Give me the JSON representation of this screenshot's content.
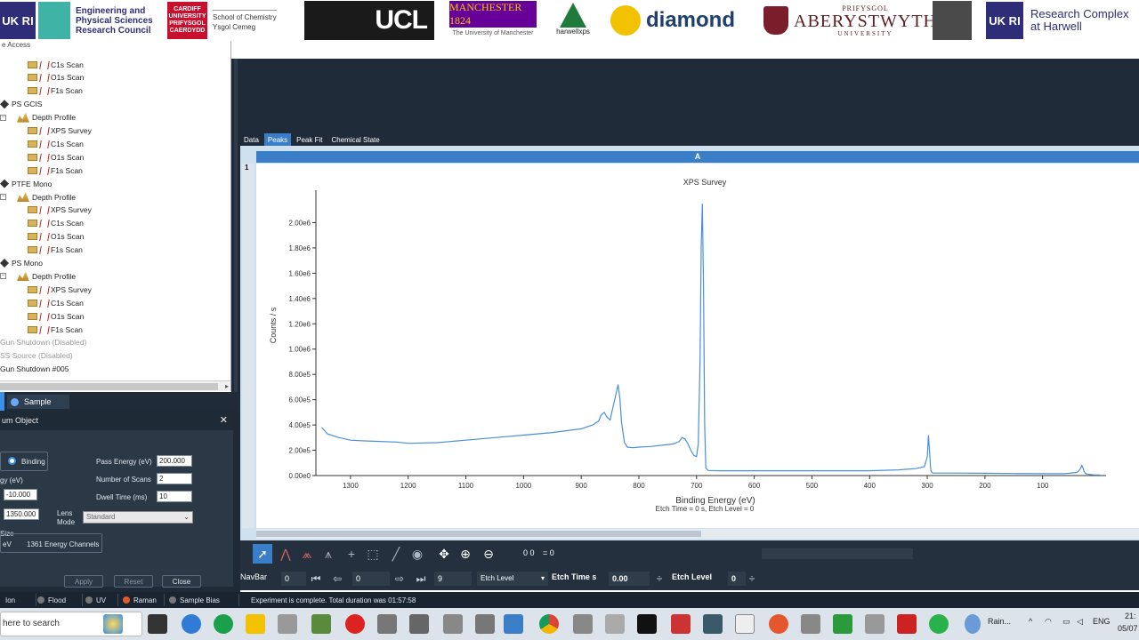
{
  "banner": {
    "ukri_mark": "UK RI",
    "epsrc_lines": [
      "Engineering and",
      "Physical Sciences",
      "Research Council"
    ],
    "cardiff_lines": [
      "CARDIFF",
      "UNIVERSITY",
      "PRIFYSGOL",
      "CAERDYDD"
    ],
    "chem_lines": [
      "School of Chemistry",
      "Ysgol Cemeg"
    ],
    "ucl": "UCL",
    "manchester": "MANCHESTER 1824",
    "manchester_sub": "The University of Manchester",
    "harwellxps": "harwellxps",
    "diamond": "diamond",
    "aber_top": "PRIFYSGOL",
    "aber_mid": "ABERYSTWYTH",
    "aber_bot": "UNIVERSITY",
    "rch_lines": [
      "Research Complex",
      "at Harwell"
    ]
  },
  "tree": {
    "header": "e Access",
    "nodes": [
      {
        "kind": "scan",
        "label": "C1s Scan",
        "indent": 2
      },
      {
        "kind": "scan",
        "label": "O1s Scan",
        "indent": 2
      },
      {
        "kind": "scan",
        "label": "F1s Scan",
        "indent": 2
      },
      {
        "kind": "sample",
        "label": "PS GCIS",
        "indent": 0
      },
      {
        "kind": "depth",
        "label": "Depth Profile",
        "indent": 1
      },
      {
        "kind": "scan",
        "label": "XPS Survey",
        "indent": 2
      },
      {
        "kind": "scan",
        "label": "C1s Scan",
        "indent": 2
      },
      {
        "kind": "scan",
        "label": "O1s Scan",
        "indent": 2
      },
      {
        "kind": "scan",
        "label": "F1s Scan",
        "indent": 2
      },
      {
        "kind": "sample",
        "label": "PTFE Mono",
        "indent": 0
      },
      {
        "kind": "depth",
        "label": "Depth Profile",
        "indent": 1
      },
      {
        "kind": "scan",
        "label": "XPS Survey",
        "indent": 2
      },
      {
        "kind": "scan",
        "label": "C1s Scan",
        "indent": 2
      },
      {
        "kind": "scan",
        "label": "O1s Scan",
        "indent": 2
      },
      {
        "kind": "scan",
        "label": "F1s Scan",
        "indent": 2
      },
      {
        "kind": "sample",
        "label": "PS Mono",
        "indent": 0
      },
      {
        "kind": "depth",
        "label": "Depth Profile",
        "indent": 1
      },
      {
        "kind": "scan",
        "label": "XPS Survey",
        "indent": 2
      },
      {
        "kind": "scan",
        "label": "C1s Scan",
        "indent": 2
      },
      {
        "kind": "scan",
        "label": "O1s Scan",
        "indent": 2
      },
      {
        "kind": "scan",
        "label": "F1s Scan",
        "indent": 2
      },
      {
        "kind": "disabled",
        "label": "Gun Shutdown (Disabled)",
        "indent": 0
      },
      {
        "kind": "disabled",
        "label": "SS Source (Disabled)",
        "indent": 0
      },
      {
        "kind": "plain",
        "label": "Gun Shutdown #005",
        "indent": 0
      }
    ]
  },
  "sample_tab": {
    "label": "Sample"
  },
  "props": {
    "title": "um Object",
    "close": "✕",
    "binding_label": "Binding",
    "energy_label": "gy (eV)",
    "start_value": "-10.000",
    "end_value": "1350.000",
    "pass_energy_label": "Pass Energy (eV)",
    "pass_energy_value": "200.000",
    "scans_label": "Number of Scans",
    "scans_value": "2",
    "dwell_label": "Dwell Time  (ms)",
    "dwell_value": "10",
    "lens_label_1": "Lens",
    "lens_label_2": "Mode",
    "lens_value": "Standard",
    "size_label": "Size",
    "channels_prefix": "eV",
    "channels": "1361 Energy Channels",
    "apply": "Apply",
    "reset": "Reset",
    "close_btn": "Close"
  },
  "tabs": [
    "Data",
    "Peaks",
    "Peak Fit",
    "Chemical State"
  ],
  "active_tab": "Peaks",
  "layer_number": "1",
  "sheet_header": "A",
  "chart_data": {
    "type": "line",
    "title": "XPS Survey",
    "xlabel": "Binding Energy (eV)",
    "ylabel": "Counts / s",
    "subtitle": "Etch Time = 0 s, Etch Level = 0",
    "xlim": [
      1360,
      -10
    ],
    "ylim": [
      0,
      2200000
    ],
    "x_ticks": [
      1300,
      1200,
      1100,
      1000,
      900,
      800,
      700,
      600,
      500,
      400,
      300,
      200,
      100
    ],
    "y_ticks": [
      "0.00e0",
      "2.00e5",
      "4.00e5",
      "6.00e5",
      "8.00e5",
      "1.00e6",
      "1.20e6",
      "1.40e6",
      "1.60e6",
      "1.80e6",
      "2.00e6"
    ],
    "y_tick_values": [
      0,
      200000,
      400000,
      600000,
      800000,
      1000000,
      1200000,
      1400000,
      1600000,
      1800000,
      2000000
    ],
    "series": [
      {
        "color": "#4a90d9",
        "x": [
          1350,
          1340,
          1320,
          1300,
          1280,
          1250,
          1220,
          1200,
          1150,
          1100,
          1050,
          1000,
          950,
          900,
          880,
          870,
          865,
          860,
          855,
          850,
          840,
          836,
          833,
          830,
          825,
          820,
          810,
          800,
          780,
          760,
          740,
          730,
          725,
          720,
          715,
          710,
          705,
          700,
          697,
          694,
          692,
          690,
          688,
          686,
          684,
          680,
          660,
          640,
          600,
          550,
          500,
          450,
          400,
          350,
          320,
          305,
          300,
          298,
          296,
          294,
          292,
          290,
          285,
          280,
          250,
          200,
          150,
          100,
          60,
          40,
          35,
          32,
          30,
          28,
          25,
          20,
          10,
          0
        ],
        "y": [
          380000,
          330000,
          300000,
          280000,
          275000,
          270000,
          265000,
          255000,
          260000,
          280000,
          300000,
          320000,
          340000,
          370000,
          400000,
          430000,
          480000,
          500000,
          460000,
          440000,
          640000,
          720000,
          610000,
          420000,
          260000,
          225000,
          220000,
          225000,
          230000,
          240000,
          250000,
          270000,
          300000,
          290000,
          250000,
          200000,
          160000,
          150000,
          250000,
          900000,
          1800000,
          2150000,
          1500000,
          400000,
          60000,
          40000,
          38000,
          38000,
          38000,
          38000,
          38000,
          38000,
          38000,
          45000,
          55000,
          70000,
          150000,
          320000,
          180000,
          40000,
          25000,
          20000,
          20000,
          20000,
          20000,
          18000,
          16000,
          15000,
          15000,
          25000,
          50000,
          80000,
          60000,
          30000,
          15000,
          10000,
          5000,
          5000
        ]
      }
    ]
  },
  "toolbar": {
    "readout_x": "0 0",
    "readout_eq": "= 0"
  },
  "navbar": {
    "label": "NavBar",
    "field_a": "0",
    "field_b": "0",
    "field_c": "9",
    "etch_level_select": "Etch Level",
    "etch_time_label": "Etch Time s",
    "etch_time_value": "0.00",
    "etch_level_label": "Etch Level",
    "etch_level_value": "0"
  },
  "statusbar": {
    "ion": "Ion",
    "flood": "Flood",
    "uv": "UV",
    "raman": "Raman",
    "sample_bias": "Sample Bias",
    "message": "Experiment is complete. Total duration was 01:57:58"
  },
  "taskbar": {
    "search": "here to search",
    "weather": "Rain...",
    "lang": "ENG",
    "time": "21:",
    "date": "05/07"
  },
  "colors": {
    "accent": "#3a7ec8",
    "dark": "#1f2b38",
    "series": "#4a90d9"
  }
}
